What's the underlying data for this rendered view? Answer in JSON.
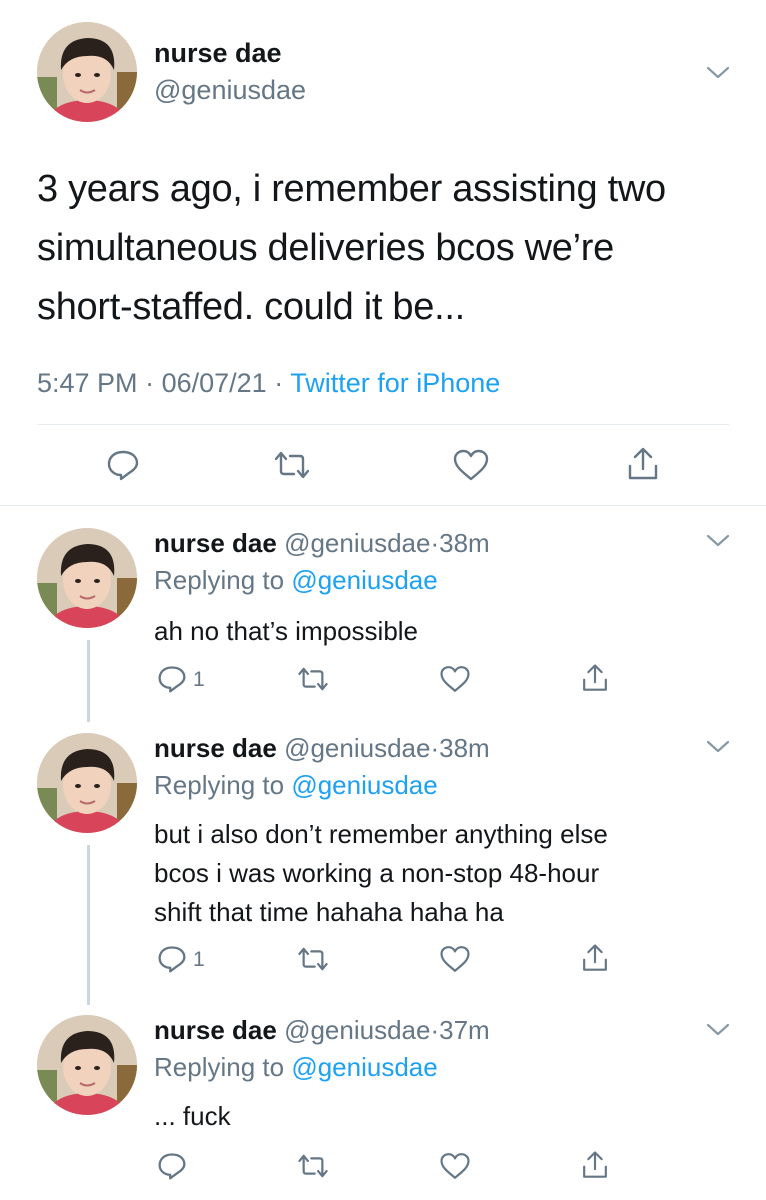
{
  "main_tweet": {
    "display_name": "nurse dae",
    "handle": "@geniusdae",
    "text_lines": [
      "3 years ago, i remember assisting two",
      "simultaneous deliveries bcos we’re",
      "short-staffed. could it be..."
    ],
    "time": "5:47 PM",
    "separator": "·",
    "date": "06/07/21",
    "source": "Twitter for iPhone"
  },
  "replies": [
    {
      "display_name": "nurse dae",
      "handle": "@geniusdae",
      "dot": "·",
      "age": "38m",
      "replying_label": "Replying to",
      "replying_handle": "@geniusdae",
      "text_lines": [
        "ah no that’s impossible"
      ],
      "reply_count": "1"
    },
    {
      "display_name": "nurse dae",
      "handle": "@geniusdae",
      "dot": "·",
      "age": "38m",
      "replying_label": "Replying to",
      "replying_handle": "@geniusdae",
      "text_lines": [
        "but i also don’t remember anything else",
        "bcos i was working a non-stop 48-hour",
        "shift that time hahaha haha ha"
      ],
      "reply_count": "1"
    },
    {
      "display_name": "nurse dae",
      "handle": "@geniusdae",
      "dot": "·",
      "age": "37m",
      "replying_label": "Replying to",
      "replying_handle": "@geniusdae",
      "text_lines": [
        "... fuck"
      ],
      "reply_count": ""
    }
  ],
  "icons": {
    "reply": "reply-icon",
    "retweet": "retweet-icon",
    "like": "heart-icon",
    "share": "share-icon",
    "more": "chevron-down-icon"
  },
  "colors": {
    "link": "#1da1f2",
    "muted": "#657786",
    "text": "#14171a"
  }
}
